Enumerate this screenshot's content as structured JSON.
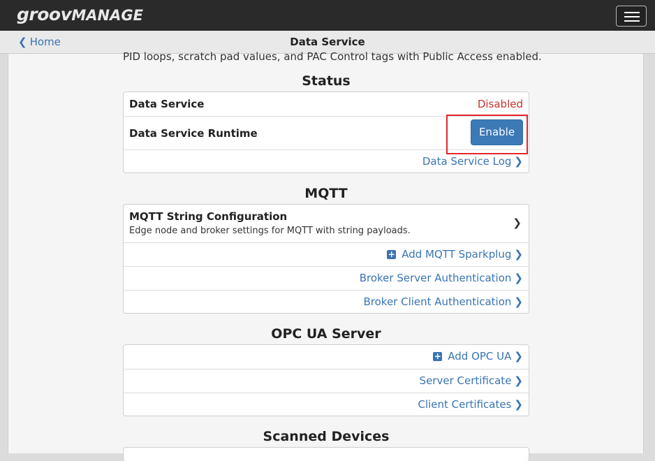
{
  "app": {
    "brand_part1": "groov",
    "brand_part2": "MANAGE"
  },
  "nav": {
    "back_label": "Home",
    "page_title": "Data Service"
  },
  "intro_text": "PID loops, scratch pad values, and PAC Control tags with Public Access enabled.",
  "status": {
    "title": "Status",
    "data_service_label": "Data Service",
    "data_service_value": "Disabled",
    "runtime_label": "Data Service Runtime",
    "enable_button": "Enable",
    "log_link": "Data Service Log"
  },
  "mqtt": {
    "title": "MQTT",
    "string_config_label": "MQTT String Configuration",
    "string_config_desc": "Edge node and broker settings for MQTT with string payloads.",
    "add_sparkplug": "Add MQTT Sparkplug",
    "broker_server_auth": "Broker Server Authentication",
    "broker_client_auth": "Broker Client Authentication"
  },
  "opcua": {
    "title": "OPC UA Server",
    "add_opcua": "Add OPC UA",
    "server_cert": "Server Certificate",
    "client_certs": "Client Certificates"
  },
  "scanned": {
    "title": "Scanned Devices"
  },
  "colors": {
    "link": "#3a74b3",
    "disabled": "#c9302c",
    "primary_button": "#3b79b7",
    "highlight": "#e3262e"
  }
}
